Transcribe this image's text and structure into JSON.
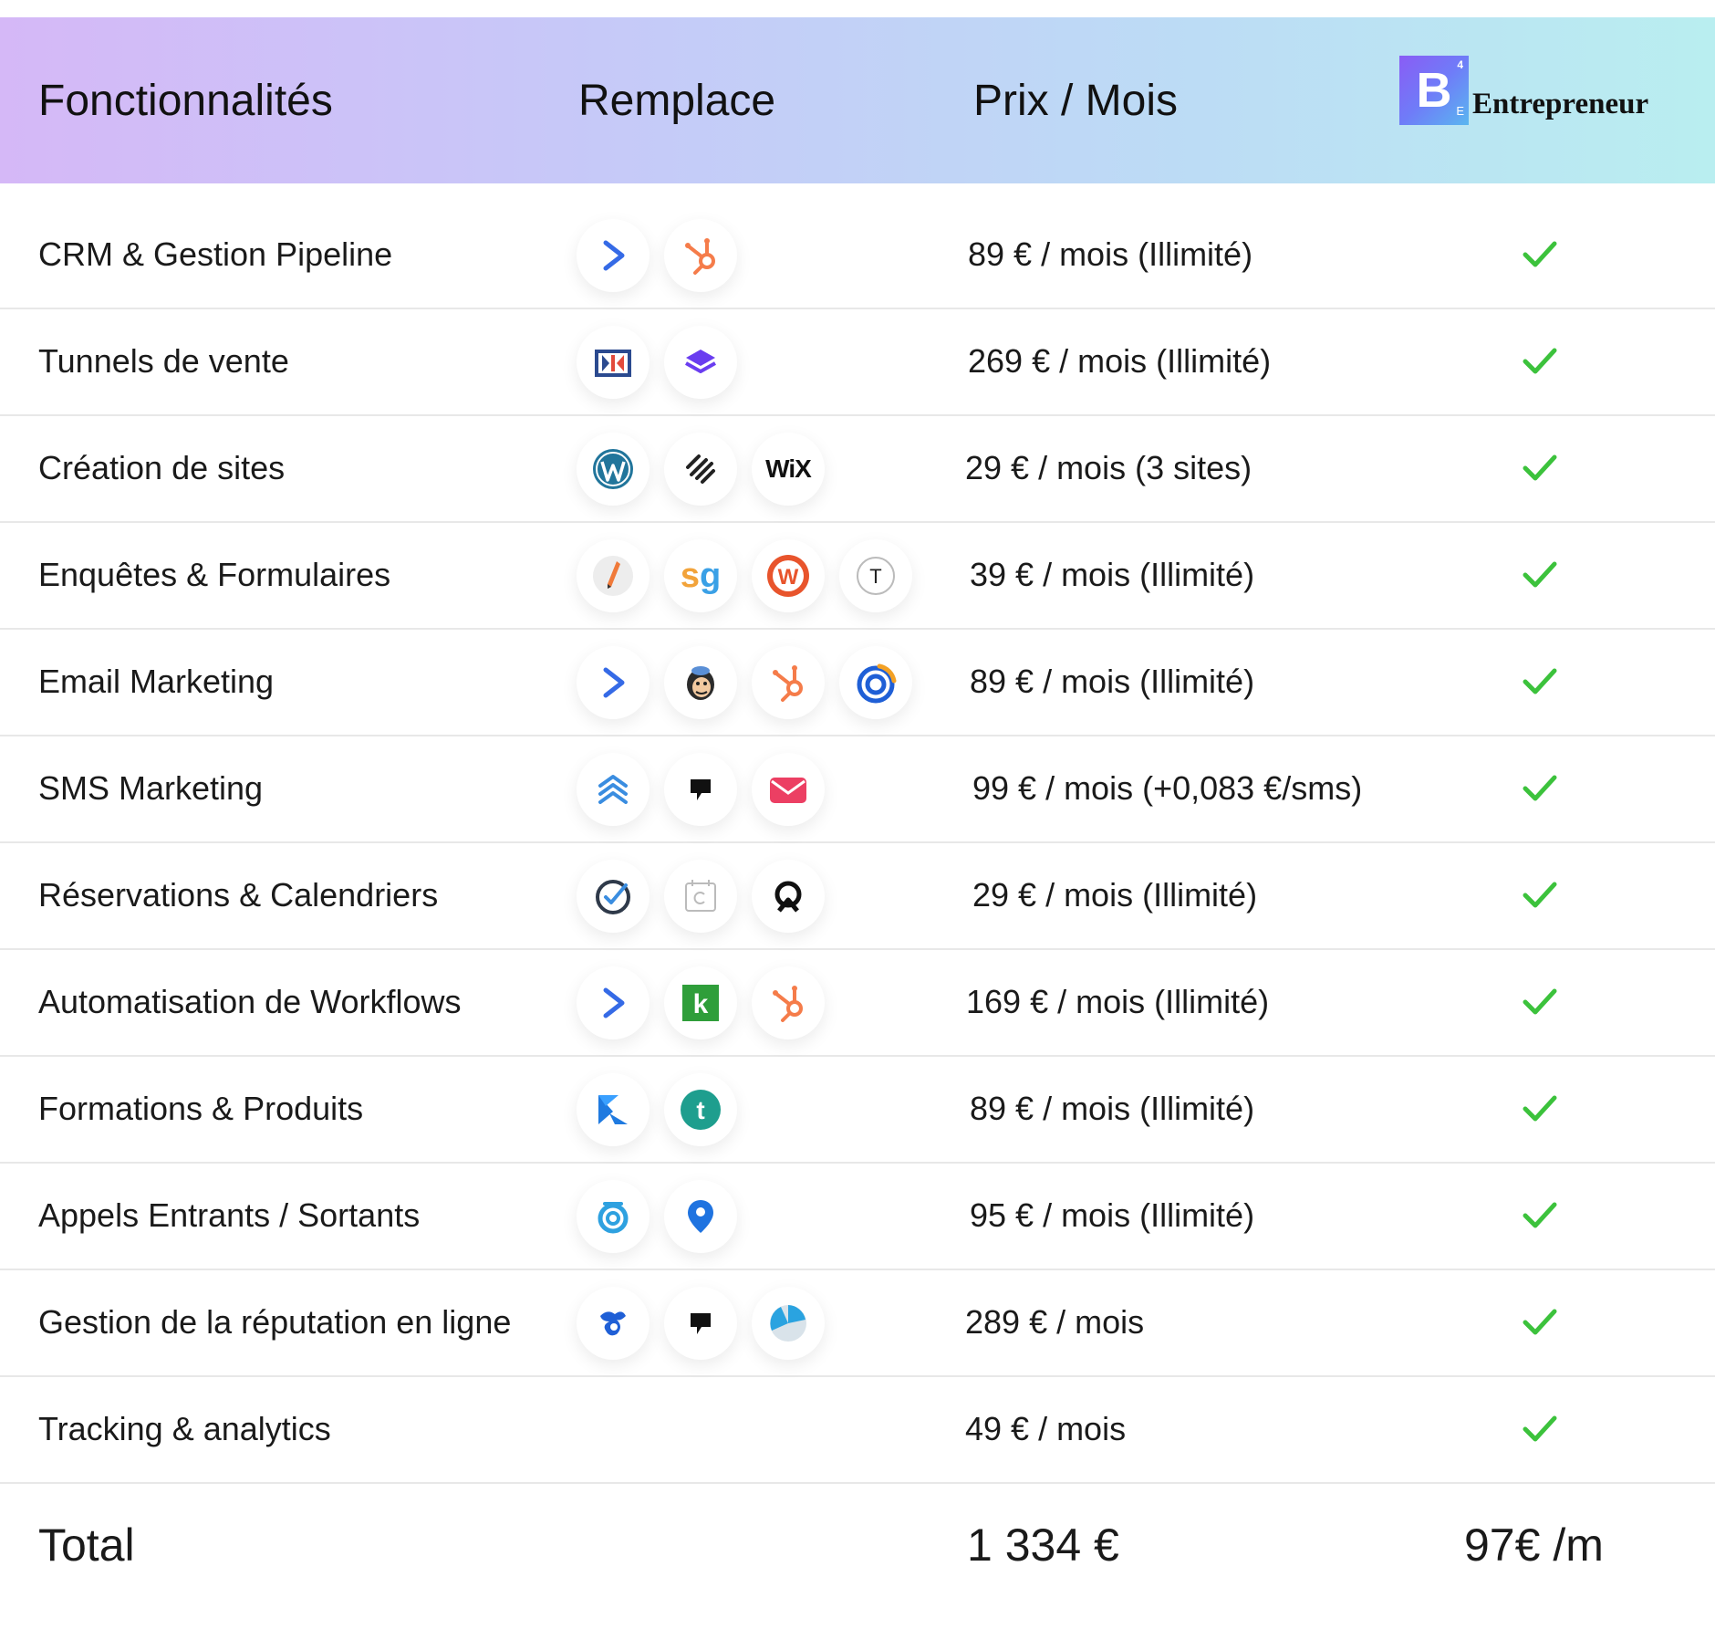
{
  "header": {
    "col_features": "Fonctionnalités",
    "col_replaces": "Remplace",
    "col_price": "Prix / Mois",
    "logo_letter": "B",
    "logo_sup": "4",
    "logo_sub": "E",
    "logo_text": "Entrepreneur"
  },
  "rows": [
    {
      "feature": "CRM & Gestion Pipeline",
      "price": "89 € / mois (Illimité)",
      "icons": [
        "activecampaign-icon",
        "hubspot-icon"
      ]
    },
    {
      "feature": "Tunnels de vente",
      "price": "269 € / mois (Illimité)",
      "icons": [
        "clickfunnels-icon",
        "layers-icon"
      ]
    },
    {
      "feature": "Création de sites",
      "price": "29 € / mois (3 sites)",
      "icons": [
        "wordpress-icon",
        "squarespace-icon",
        "wix-icon"
      ]
    },
    {
      "feature": "Enquêtes & Formulaires",
      "price": "39 € / mois (Illimité)",
      "icons": [
        "jotform-pen-icon",
        "surveygizmo-icon",
        "wufoo-icon",
        "typeform-icon"
      ]
    },
    {
      "feature": "Email Marketing",
      "price": "89 € / mois (Illimité)",
      "icons": [
        "activecampaign-icon",
        "mailchimp-icon",
        "hubspot-icon",
        "constant-contact-icon"
      ]
    },
    {
      "feature": "SMS Marketing",
      "price": "99 € / mois (+0,083 €/sms)",
      "icons": [
        "chevrons-icon",
        "podium-icon",
        "envelope-icon"
      ]
    },
    {
      "feature": "Réservations & Calendriers",
      "price": "29 € / mois (Illimité)",
      "icons": [
        "acuity-check-icon",
        "calendar-icon",
        "calendly-icon"
      ]
    },
    {
      "feature": "Automatisation de Workflows",
      "price": "169 € / mois (Illimité)",
      "icons": [
        "activecampaign-icon",
        "keap-icon",
        "hubspot-icon"
      ]
    },
    {
      "feature": "Formations & Produits",
      "price": "89 € / mois (Illimité)",
      "icons": [
        "kajabi-icon",
        "teachable-icon"
      ]
    },
    {
      "feature": "Appels Entrants / Sortants",
      "price": "95 € / mois (Illimité)",
      "icons": [
        "callrail-icon",
        "location-pin-icon"
      ]
    },
    {
      "feature": "Gestion de la réputation en ligne",
      "price": "289 € / mois",
      "icons": [
        "birdeye-icon",
        "podium-icon",
        "pie-icon"
      ]
    },
    {
      "feature": "Tracking & analytics",
      "price": "49 € / mois",
      "icons": []
    }
  ],
  "icon_glyphs": {
    "wix": "WiX",
    "surveygizmo": "sg",
    "wufoo": "W",
    "typeform": "T",
    "keap": "k",
    "teachable": "t"
  },
  "total": {
    "label": "Total",
    "price": "1 334 €",
    "offer": "97€ /m"
  },
  "colors": {
    "check": "#3cc23c",
    "hubspot": "#f57c4a",
    "activecampaign": "#356ae6",
    "header_start": "#d5b8f7",
    "header_end": "#b9eef0"
  }
}
